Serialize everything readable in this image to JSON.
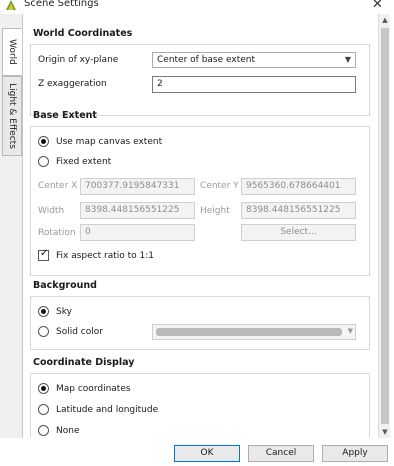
{
  "window": {
    "title": "Scene Settings",
    "close_glyph": "✕"
  },
  "tabs": [
    {
      "label": "World"
    },
    {
      "label": "Light & Effects"
    }
  ],
  "world_coordinates": {
    "title": "World Coordinates",
    "origin_label": "Origin of xy-plane",
    "origin_value": "Center of base extent",
    "z_label": "Z exaggeration",
    "z_value": "2"
  },
  "base_extent": {
    "title": "Base Extent",
    "use_canvas_label": "Use map canvas extent",
    "fixed_label": "Fixed extent",
    "center_x_label": "Center X",
    "center_x_value": "700377.9195847331",
    "center_y_label": "Center Y",
    "center_y_value": "9565360.678664401",
    "width_label": "Width",
    "width_value": "8398.448156551225",
    "height_label": "Height",
    "height_value": "8398.448156551225",
    "rotation_label": "Rotation",
    "rotation_value": "0",
    "select_label": "Select...",
    "fix_aspect_label": "Fix aspect ratio to 1:1"
  },
  "background": {
    "title": "Background",
    "sky_label": "Sky",
    "solid_label": "Solid color",
    "solid_color": "#b9b9b9"
  },
  "coordinate_display": {
    "title": "Coordinate Display",
    "map_label": "Map coordinates",
    "latlon_label": "Latitude and longitude",
    "none_label": "None"
  },
  "footer": {
    "ok_label": "OK",
    "cancel_label": "Cancel",
    "apply_label": "Apply"
  },
  "colors": {
    "accent": "#0078d7",
    "disabled_text": "#8e8e8e"
  }
}
